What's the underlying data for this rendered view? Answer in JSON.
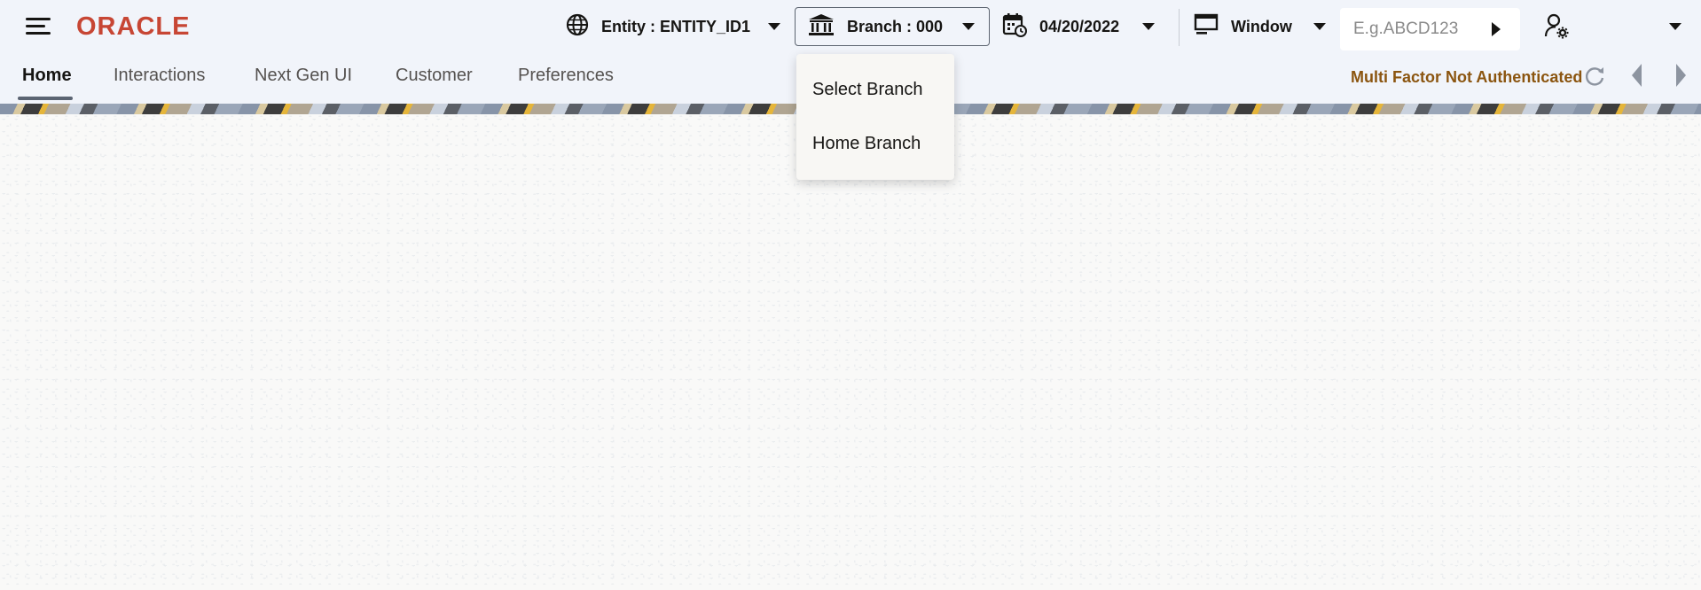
{
  "brand": {
    "logo_text": "ORACLE",
    "logo_color": "#c74634"
  },
  "header": {
    "entity_label": "Entity : ENTITY_ID1",
    "branch_label": "Branch : 000",
    "date_label": "04/20/2022",
    "window_label": "Window",
    "search_placeholder": "E.g.ABCD123",
    "search_value": ""
  },
  "icons": {
    "menu": "hamburger-menu-icon",
    "entity": "globe-icon",
    "branch": "bank-building-icon",
    "date": "calendar-clock-icon",
    "window": "monitor-icon",
    "search_go": "play-arrow-icon",
    "user": "user-settings-icon",
    "refresh": "refresh-icon",
    "prev": "chevron-left-icon",
    "next": "chevron-right-icon"
  },
  "nav": {
    "tabs": [
      {
        "label": "Home",
        "active": true
      },
      {
        "label": "Interactions",
        "active": false
      },
      {
        "label": "Next Gen UI",
        "active": false
      },
      {
        "label": "Customer",
        "active": false
      },
      {
        "label": "Preferences",
        "active": false
      }
    ],
    "mfa_status": "Multi Factor Not Authenticated",
    "mfa_color": "#8b5510"
  },
  "branch_menu": {
    "items": [
      "Select Branch",
      "Home Branch"
    ]
  }
}
